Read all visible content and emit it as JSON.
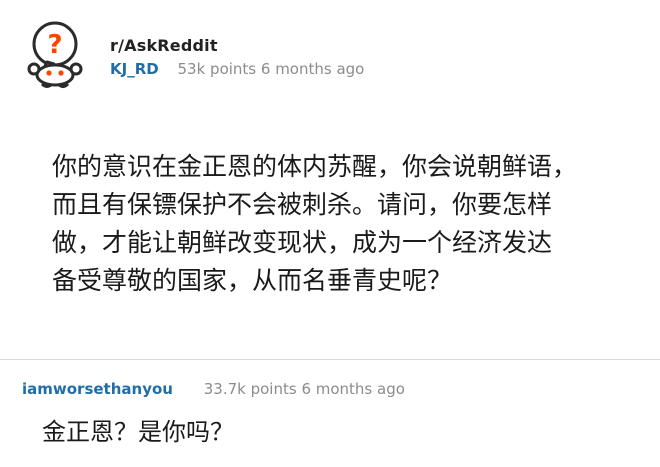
{
  "post": {
    "subreddit": "r/AskReddit",
    "author": "KJ_RD",
    "meta": "53k points 6 months ago",
    "icon": "reddit-alien-question-icon",
    "body": "你的意识在金正恩的体内苏醒，你会说朝鲜语，\n而且有保镖保护不会被刺杀。请问，你要怎样\n做，才能让朝鲜改变现状，成为一个经济发达\n备受尊敬的国家，从而名垂青史呢？"
  },
  "comment": {
    "author": "iamworsethanyou",
    "meta": "33.7k points 6 months ago",
    "text": "金正恩？是你吗？"
  },
  "colors": {
    "author_link": "#1f6ea8",
    "meta_gray": "#8c8c8c",
    "icon_red": "#ff4500",
    "text": "#1a1a1b"
  }
}
